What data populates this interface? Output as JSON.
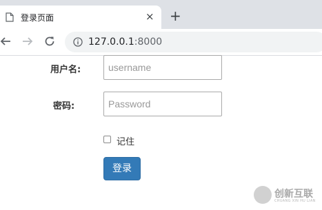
{
  "browser": {
    "tab_title": "登录页面",
    "tab_close": "×",
    "new_tab": "+",
    "url_host": "127.0.0.1",
    "url_port": ":8000"
  },
  "form": {
    "username_label": "用户名:",
    "username_placeholder": "username",
    "password_label": "密码:",
    "password_placeholder": "Password",
    "remember_label": "记住",
    "remember_checked": false,
    "submit_label": "登录"
  },
  "watermark": {
    "text": "创新互联",
    "sub": "CHUANG XIN HU LIAN"
  },
  "colors": {
    "button": "#337ab7",
    "tabbar": "#dee1e6",
    "omnibox": "#f1f3f4"
  },
  "icons": {
    "tab": "page-icon",
    "back": "arrow-left-icon",
    "forward": "arrow-right-icon",
    "reload": "reload-icon",
    "site_info": "info-icon"
  }
}
